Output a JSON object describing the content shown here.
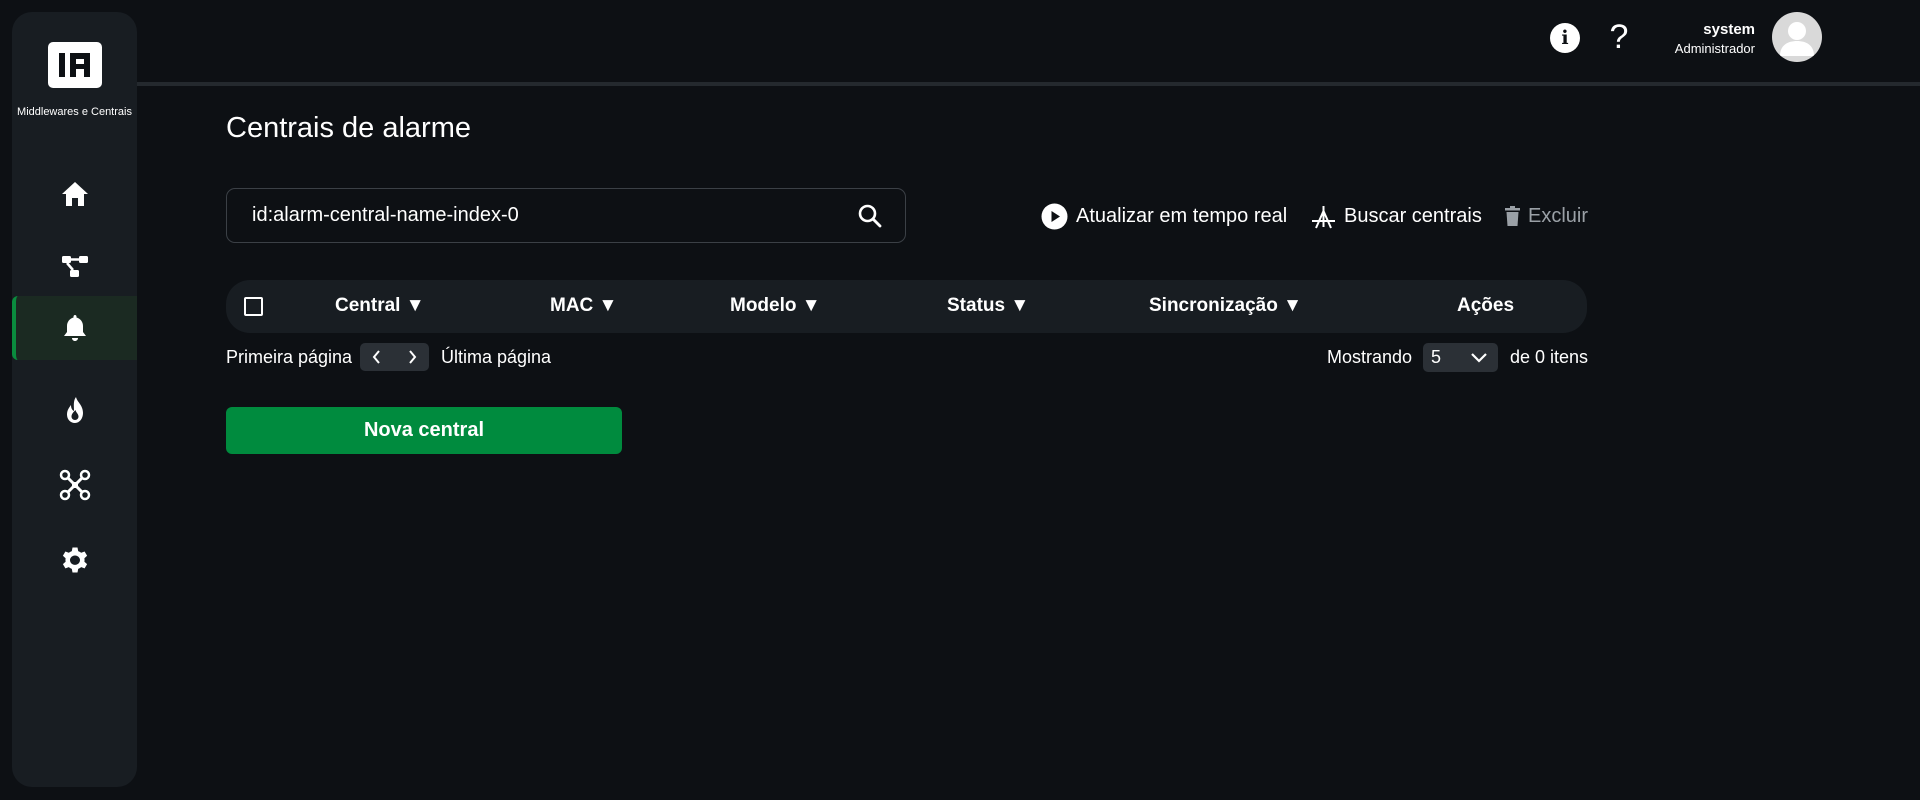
{
  "sidebar": {
    "logo_text": "IA",
    "brand": "Middlewares e Centrais",
    "items": [
      {
        "name": "home",
        "icon": "home-icon"
      },
      {
        "name": "network",
        "icon": "network-icon"
      },
      {
        "name": "alarm",
        "icon": "bell-icon",
        "active": true
      },
      {
        "name": "fire",
        "icon": "fire-icon"
      },
      {
        "name": "drone",
        "icon": "drone-icon"
      },
      {
        "name": "settings",
        "icon": "gear-icon"
      }
    ]
  },
  "header": {
    "user_name": "system",
    "user_role": "Administrador",
    "info_icon": "info-icon",
    "help_icon": "help-icon"
  },
  "page": {
    "title": "Centrais de alarme"
  },
  "search": {
    "value": "id:alarm-central-name-index-0"
  },
  "actions": {
    "realtime": "Atualizar em tempo real",
    "search_centrals": "Buscar centrais",
    "delete": "Excluir"
  },
  "table": {
    "columns": [
      "Central ▼",
      "MAC ▼",
      "Modelo ▼",
      "Status ▼",
      "Sincronização ▼",
      "Ações"
    ],
    "rows": []
  },
  "pagination": {
    "first": "Primeira página",
    "last": "Última página",
    "showing": "Mostrando",
    "page_size": "5",
    "total": "de 0 itens"
  },
  "buttons": {
    "new_central": "Nova central"
  },
  "colors": {
    "background": "#0d1014",
    "sidebar": "#181d22",
    "accent": "#008b3e"
  }
}
